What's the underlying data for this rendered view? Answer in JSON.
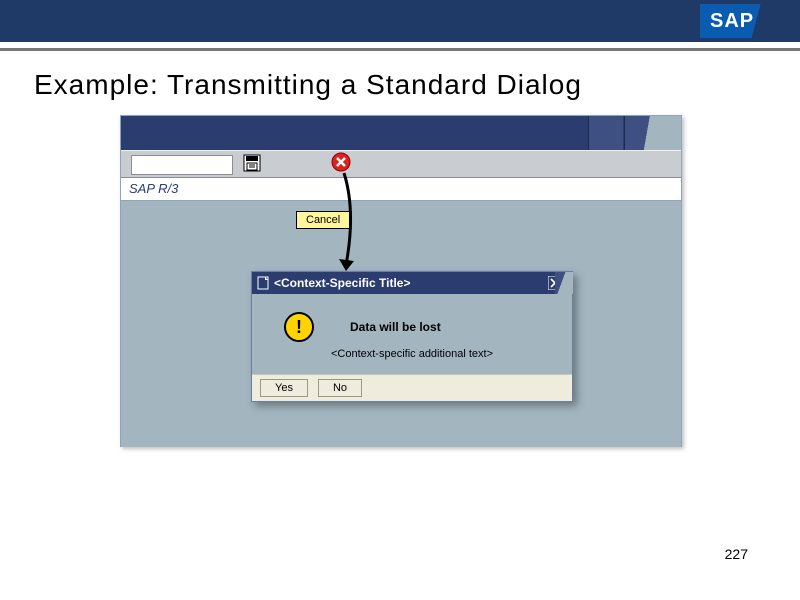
{
  "logo": "SAP",
  "slide_title": "Example: Transmitting a Standard Dialog",
  "app_label": "SAP R/3",
  "tooltip": "Cancel",
  "dialog": {
    "title": "<Context-Specific Title>",
    "main_message": "Data will be lost",
    "sub_message": "<Context-specific additional text>",
    "yes": "Yes",
    "no": "No"
  },
  "page_number": "227"
}
